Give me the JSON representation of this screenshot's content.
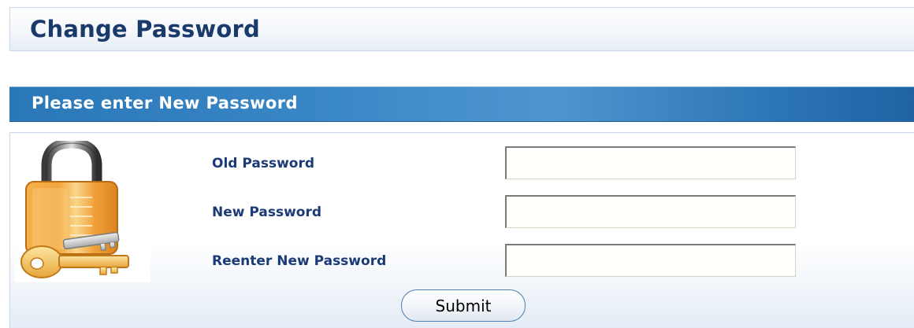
{
  "page": {
    "title": "Change Password"
  },
  "section": {
    "header": "Please enter New Password"
  },
  "form": {
    "fields": [
      {
        "label": "Old Password",
        "value": ""
      },
      {
        "label": "New Password",
        "value": ""
      },
      {
        "label": "Reenter New Password",
        "value": ""
      }
    ],
    "submit_label": "Submit"
  },
  "icons": {
    "padlock": "padlock-with-keys-icon"
  },
  "colors": {
    "title_text": "#1a3a6c",
    "header_bar": "#3a87c6",
    "label_text": "#1b3a78",
    "padlock_gold": "#f2a43a"
  }
}
